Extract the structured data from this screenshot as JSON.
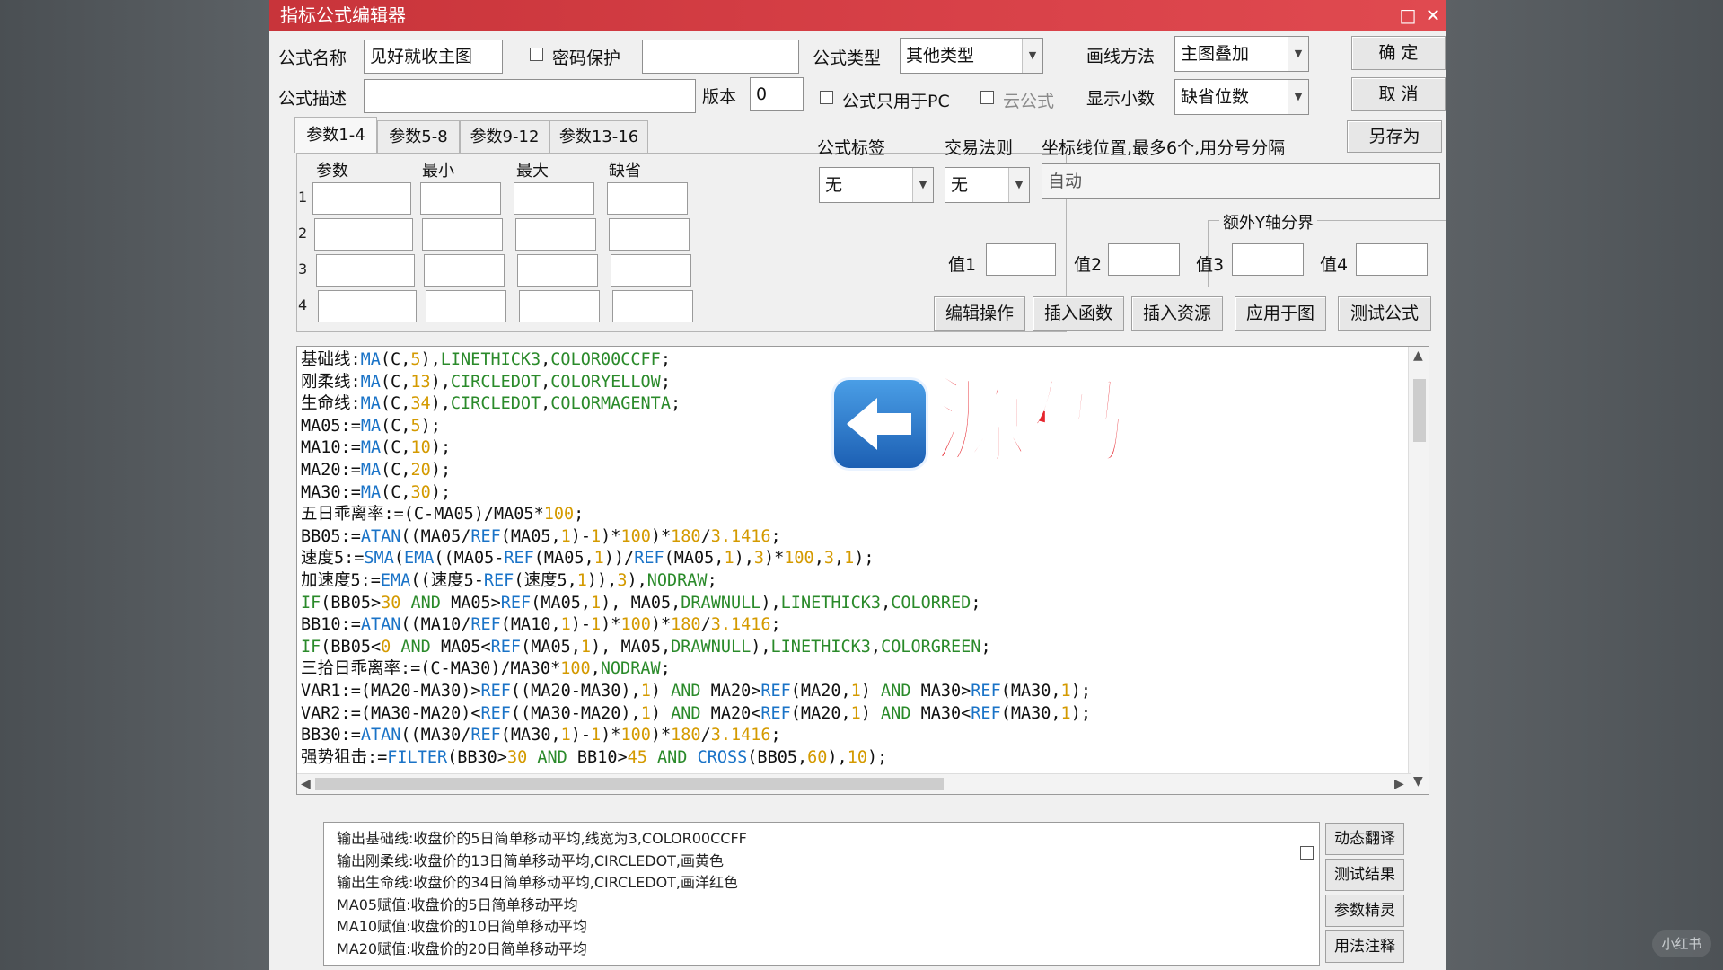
{
  "window": {
    "title": "指标公式编辑器"
  },
  "form": {
    "name_label": "公式名称",
    "name_value": "见好就收主图",
    "password_label": "密码保护",
    "desc_label": "公式描述",
    "version_label": "版本",
    "version_value": "0",
    "type_label": "公式类型",
    "type_value": "其他类型",
    "draw_label": "画线方法",
    "draw_value": "主图叠加",
    "pc_only_label": "公式只用于PC",
    "cloud_label": "云公式",
    "decimal_label": "显示小数",
    "decimal_value": "缺省位数",
    "tag_label": "公式标签",
    "tag_value": "无",
    "rule_label": "交易法则",
    "rule_value": "无",
    "coord_label": "坐标线位置,最多6个,用分号分隔",
    "coord_value": "自动",
    "yaxis_label": "额外Y轴分界",
    "val1": "值1",
    "val2": "值2",
    "val3": "值3",
    "val4": "值4"
  },
  "buttons": {
    "ok": "确 定",
    "cancel": "取 消",
    "save_as": "另存为",
    "edit_ops": "编辑操作",
    "insert_func": "插入函数",
    "insert_res": "插入资源",
    "apply": "应用于图",
    "test": "测试公式"
  },
  "tabs": [
    "参数1-4",
    "参数5-8",
    "参数9-12",
    "参数13-16"
  ],
  "params": {
    "headers": [
      "参数",
      "最小",
      "最大",
      "缺省"
    ],
    "rows": [
      "1",
      "2",
      "3",
      "4"
    ]
  },
  "code": [
    [
      [
        "v",
        "基础线:"
      ],
      [
        "f",
        "MA"
      ],
      [
        "v",
        "(C,"
      ],
      [
        "n",
        "5"
      ],
      [
        "v",
        "),"
      ],
      [
        "k",
        "LINETHICK3"
      ],
      [
        "v",
        ","
      ],
      [
        "k",
        "COLOR00CCFF"
      ],
      [
        "v",
        ";"
      ]
    ],
    [
      [
        "v",
        "刚柔线:"
      ],
      [
        "f",
        "MA"
      ],
      [
        "v",
        "(C,"
      ],
      [
        "n",
        "13"
      ],
      [
        "v",
        "),"
      ],
      [
        "k",
        "CIRCLEDOT"
      ],
      [
        "v",
        ","
      ],
      [
        "k",
        "COLORYELLOW"
      ],
      [
        "v",
        ";"
      ]
    ],
    [
      [
        "v",
        "生命线:"
      ],
      [
        "f",
        "MA"
      ],
      [
        "v",
        "(C,"
      ],
      [
        "n",
        "34"
      ],
      [
        "v",
        "),"
      ],
      [
        "k",
        "CIRCLEDOT"
      ],
      [
        "v",
        ","
      ],
      [
        "k",
        "COLORMAGENTA"
      ],
      [
        "v",
        ";"
      ]
    ],
    [
      [
        "v",
        "MA05:="
      ],
      [
        "f",
        "MA"
      ],
      [
        "v",
        "(C,"
      ],
      [
        "n",
        "5"
      ],
      [
        "v",
        ");"
      ]
    ],
    [
      [
        "v",
        "MA10:="
      ],
      [
        "f",
        "MA"
      ],
      [
        "v",
        "(C,"
      ],
      [
        "n",
        "10"
      ],
      [
        "v",
        ");"
      ]
    ],
    [
      [
        "v",
        "MA20:="
      ],
      [
        "f",
        "MA"
      ],
      [
        "v",
        "(C,"
      ],
      [
        "n",
        "20"
      ],
      [
        "v",
        ");"
      ]
    ],
    [
      [
        "v",
        "MA30:="
      ],
      [
        "f",
        "MA"
      ],
      [
        "v",
        "(C,"
      ],
      [
        "n",
        "30"
      ],
      [
        "v",
        ");"
      ]
    ],
    [
      [
        "v",
        "五日乖离率:=(C-MA05)/MA05*"
      ],
      [
        "n",
        "100"
      ],
      [
        "v",
        ";"
      ]
    ],
    [
      [
        "v",
        "BB05:="
      ],
      [
        "f",
        "ATAN"
      ],
      [
        "v",
        "((MA05/"
      ],
      [
        "f",
        "REF"
      ],
      [
        "v",
        "(MA05,"
      ],
      [
        "n",
        "1"
      ],
      [
        "v",
        ")-"
      ],
      [
        "n",
        "1"
      ],
      [
        "v",
        ")*"
      ],
      [
        "n",
        "100"
      ],
      [
        "v",
        ")*"
      ],
      [
        "n",
        "180"
      ],
      [
        "v",
        "/"
      ],
      [
        "n",
        "3.1416"
      ],
      [
        "v",
        ";"
      ]
    ],
    [
      [
        "v",
        "速度5:="
      ],
      [
        "f",
        "SMA"
      ],
      [
        "v",
        "("
      ],
      [
        "f",
        "EMA"
      ],
      [
        "v",
        "((MA05-"
      ],
      [
        "f",
        "REF"
      ],
      [
        "v",
        "(MA05,"
      ],
      [
        "n",
        "1"
      ],
      [
        "v",
        "))/"
      ],
      [
        "f",
        "REF"
      ],
      [
        "v",
        "(MA05,"
      ],
      [
        "n",
        "1"
      ],
      [
        "v",
        "),"
      ],
      [
        "n",
        "3"
      ],
      [
        "v",
        ")*"
      ],
      [
        "n",
        "100"
      ],
      [
        "v",
        ","
      ],
      [
        "n",
        "3"
      ],
      [
        "v",
        ","
      ],
      [
        "n",
        "1"
      ],
      [
        "v",
        ");"
      ]
    ],
    [
      [
        "v",
        "加速度5:="
      ],
      [
        "f",
        "EMA"
      ],
      [
        "v",
        "((速度5-"
      ],
      [
        "f",
        "REF"
      ],
      [
        "v",
        "(速度5,"
      ],
      [
        "n",
        "1"
      ],
      [
        "v",
        ")),"
      ],
      [
        "n",
        "3"
      ],
      [
        "v",
        "),"
      ],
      [
        "k",
        "NODRAW"
      ],
      [
        "v",
        ";"
      ]
    ],
    [
      [
        "k",
        "IF"
      ],
      [
        "v",
        "(BB05>"
      ],
      [
        "n",
        "30"
      ],
      [
        "v",
        " "
      ],
      [
        "k",
        "AND"
      ],
      [
        "v",
        " MA05>"
      ],
      [
        "f",
        "REF"
      ],
      [
        "v",
        "(MA05,"
      ],
      [
        "n",
        "1"
      ],
      [
        "v",
        "), MA05,"
      ],
      [
        "k",
        "DRAWNULL"
      ],
      [
        "v",
        "),"
      ],
      [
        "k",
        "LINETHICK3"
      ],
      [
        "v",
        ","
      ],
      [
        "k",
        "COLORRED"
      ],
      [
        "v",
        ";"
      ]
    ],
    [
      [
        "v",
        "BB10:="
      ],
      [
        "f",
        "ATAN"
      ],
      [
        "v",
        "((MA10/"
      ],
      [
        "f",
        "REF"
      ],
      [
        "v",
        "(MA10,"
      ],
      [
        "n",
        "1"
      ],
      [
        "v",
        ")-"
      ],
      [
        "n",
        "1"
      ],
      [
        "v",
        ")*"
      ],
      [
        "n",
        "100"
      ],
      [
        "v",
        ")*"
      ],
      [
        "n",
        "180"
      ],
      [
        "v",
        "/"
      ],
      [
        "n",
        "3.1416"
      ],
      [
        "v",
        ";"
      ]
    ],
    [
      [
        "k",
        "IF"
      ],
      [
        "v",
        "(BB05<"
      ],
      [
        "n",
        "0"
      ],
      [
        "v",
        " "
      ],
      [
        "k",
        "AND"
      ],
      [
        "v",
        " MA05<"
      ],
      [
        "f",
        "REF"
      ],
      [
        "v",
        "(MA05,"
      ],
      [
        "n",
        "1"
      ],
      [
        "v",
        "), MA05,"
      ],
      [
        "k",
        "DRAWNULL"
      ],
      [
        "v",
        "),"
      ],
      [
        "k",
        "LINETHICK3"
      ],
      [
        "v",
        ","
      ],
      [
        "k",
        "COLORGREEN"
      ],
      [
        "v",
        ";"
      ]
    ],
    [
      [
        "v",
        "三拾日乖离率:=(C-MA30)/MA30*"
      ],
      [
        "n",
        "100"
      ],
      [
        "v",
        ","
      ],
      [
        "k",
        "NODRAW"
      ],
      [
        "v",
        ";"
      ]
    ],
    [
      [
        "v",
        "VAR1:=(MA20-MA30)>"
      ],
      [
        "f",
        "REF"
      ],
      [
        "v",
        "((MA20-MA30),"
      ],
      [
        "n",
        "1"
      ],
      [
        "v",
        ") "
      ],
      [
        "k",
        "AND"
      ],
      [
        "v",
        " MA20>"
      ],
      [
        "f",
        "REF"
      ],
      [
        "v",
        "(MA20,"
      ],
      [
        "n",
        "1"
      ],
      [
        "v",
        ") "
      ],
      [
        "k",
        "AND"
      ],
      [
        "v",
        " MA30>"
      ],
      [
        "f",
        "REF"
      ],
      [
        "v",
        "(MA30,"
      ],
      [
        "n",
        "1"
      ],
      [
        "v",
        ");"
      ]
    ],
    [
      [
        "v",
        "VAR2:=(MA30-MA20)<"
      ],
      [
        "f",
        "REF"
      ],
      [
        "v",
        "((MA30-MA20),"
      ],
      [
        "n",
        "1"
      ],
      [
        "v",
        ") "
      ],
      [
        "k",
        "AND"
      ],
      [
        "v",
        " MA20<"
      ],
      [
        "f",
        "REF"
      ],
      [
        "v",
        "(MA20,"
      ],
      [
        "n",
        "1"
      ],
      [
        "v",
        ") "
      ],
      [
        "k",
        "AND"
      ],
      [
        "v",
        " MA30<"
      ],
      [
        "f",
        "REF"
      ],
      [
        "v",
        "(MA30,"
      ],
      [
        "n",
        "1"
      ],
      [
        "v",
        ");"
      ]
    ],
    [
      [
        "v",
        "BB30:="
      ],
      [
        "f",
        "ATAN"
      ],
      [
        "v",
        "((MA30/"
      ],
      [
        "f",
        "REF"
      ],
      [
        "v",
        "(MA30,"
      ],
      [
        "n",
        "1"
      ],
      [
        "v",
        ")-"
      ],
      [
        "n",
        "1"
      ],
      [
        "v",
        ")*"
      ],
      [
        "n",
        "100"
      ],
      [
        "v",
        ")*"
      ],
      [
        "n",
        "180"
      ],
      [
        "v",
        "/"
      ],
      [
        "n",
        "3.1416"
      ],
      [
        "v",
        ";"
      ]
    ],
    [
      [
        "v",
        "强势狙击:="
      ],
      [
        "f",
        "FILTER"
      ],
      [
        "v",
        "(BB30>"
      ],
      [
        "n",
        "30"
      ],
      [
        "v",
        " "
      ],
      [
        "k",
        "AND"
      ],
      [
        "v",
        " BB10>"
      ],
      [
        "n",
        "45"
      ],
      [
        "v",
        " "
      ],
      [
        "k",
        "AND"
      ],
      [
        "v",
        " "
      ],
      [
        "f",
        "CROSS"
      ],
      [
        "v",
        "(BB05,"
      ],
      [
        "n",
        "60"
      ],
      [
        "v",
        "),"
      ],
      [
        "n",
        "10"
      ],
      [
        "v",
        ");"
      ]
    ]
  ],
  "overlay": {
    "text": "源码",
    "icon": "arrow-left-icon"
  },
  "output_lines": [
    "输出基础线:收盘价的5日简单移动平均,线宽为3,COLOR00CCFF",
    "输出刚柔线:收盘价的13日简单移动平均,CIRCLEDOT,画黄色",
    "输出生命线:收盘价的34日简单移动平均,CIRCLEDOT,画洋红色",
    "MA05赋值:收盘价的5日简单移动平均",
    "MA10赋值:收盘价的10日简单移动平均",
    "MA20赋值:收盘价的20日简单移动平均"
  ],
  "side_buttons": [
    "动态翻译",
    "测试结果",
    "参数精灵",
    "用法注释"
  ],
  "watermark": "小红书",
  "colors": {
    "title_bar": "#d84148",
    "func": "#1a73c7",
    "number": "#d49a00",
    "keyword": "#2a8a2a",
    "overlay_red": "#e6262e"
  }
}
